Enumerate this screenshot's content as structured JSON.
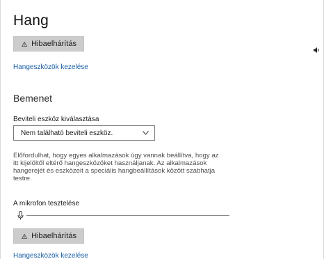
{
  "page": {
    "title": "Hang"
  },
  "output": {
    "troubleshoot_label": "Hibaelhárítás",
    "manage_devices_link": "Hangeszközök kezelése"
  },
  "input": {
    "section_title": "Bemenet",
    "device_select_label": "Beviteli eszköz kiválasztása",
    "device_select_value": "Nem található beviteli eszköz.",
    "description": "Előfordulhat, hogy egyes alkalmazások úgy vannak beállítva, hogy az itt kijelöltől eltérő hangeszközöket használjanak. Az alkalmazások hangerejét és eszközeit a speciális hangbeállítások között szabhatja testre.",
    "mic_test_label": "A mikrofon tesztelése",
    "mic_level": 0,
    "troubleshoot_label": "Hibaelhárítás",
    "manage_devices_link": "Hangeszközök kezelése"
  },
  "icons": {
    "warning": "warning-triangle-icon",
    "speaker": "speaker-icon",
    "microphone": "microphone-icon",
    "chevron": "chevron-down-icon"
  },
  "colors": {
    "link": "#1a5fa8",
    "button_bg": "#cccccc"
  }
}
